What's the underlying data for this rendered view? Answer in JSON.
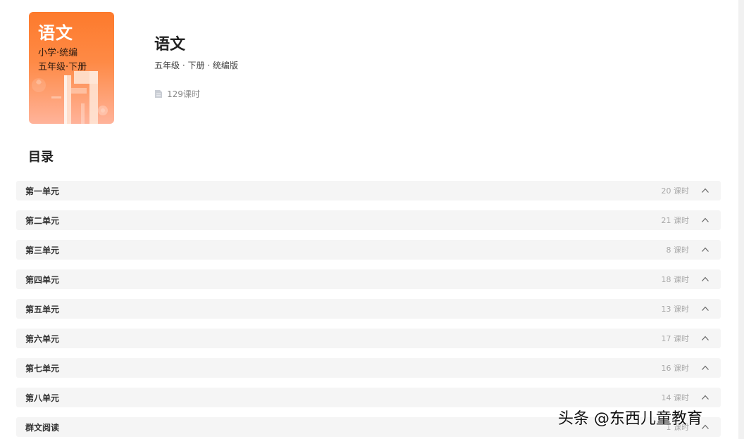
{
  "book": {
    "cover": {
      "subject": "语文",
      "line1": "小学·统编",
      "line2": "五年级·下册"
    },
    "title": "语文",
    "meta": "五年级 · 下册 · 统编版",
    "lesson_count": "129课时"
  },
  "toc": {
    "heading": "目录",
    "units": [
      {
        "name": "第一单元",
        "count": "20 课时"
      },
      {
        "name": "第二单元",
        "count": "21 课时"
      },
      {
        "name": "第三单元",
        "count": "8 课时"
      },
      {
        "name": "第四单元",
        "count": "18 课时"
      },
      {
        "name": "第五单元",
        "count": "13 课时"
      },
      {
        "name": "第六单元",
        "count": "17 课时"
      },
      {
        "name": "第七单元",
        "count": "16 课时"
      },
      {
        "name": "第八单元",
        "count": "14 课时"
      },
      {
        "name": "群文阅读",
        "count": "1 课时"
      }
    ]
  },
  "watermark": "头条 @东西儿童教育",
  "colors": {
    "cover_top": "#fd7a2c",
    "cover_bottom": "#ffb39a",
    "row_bg": "#f5f5f5"
  },
  "icons": {
    "lesson": "document-icon",
    "expand": "chevron-up-icon"
  }
}
